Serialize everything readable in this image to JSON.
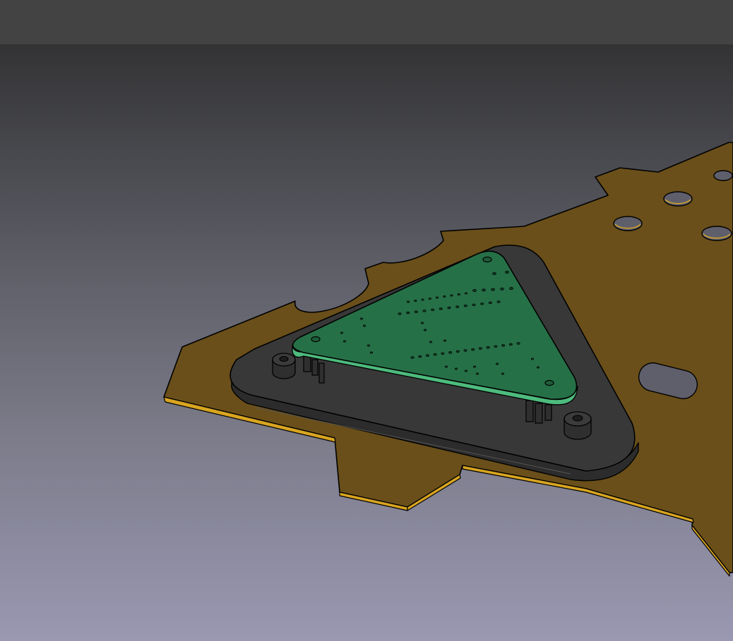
{
  "app": {
    "viewport_label": "3D viewport"
  },
  "colors": {
    "toolbar": "#434343",
    "background_top": "#333335",
    "background_bottom": "#9a98b2",
    "plate_face": "#6a4f1a",
    "plate_edge": "#d9a520",
    "base_face": "#373737",
    "base_side": "#2e2e2e",
    "pcb_face": "#267047",
    "pcb_edge": "#4dbb7d",
    "outline": "#000000"
  },
  "scene": {
    "objects": [
      "mounting-plate",
      "base-plate",
      "pcb",
      "standoffs"
    ]
  }
}
